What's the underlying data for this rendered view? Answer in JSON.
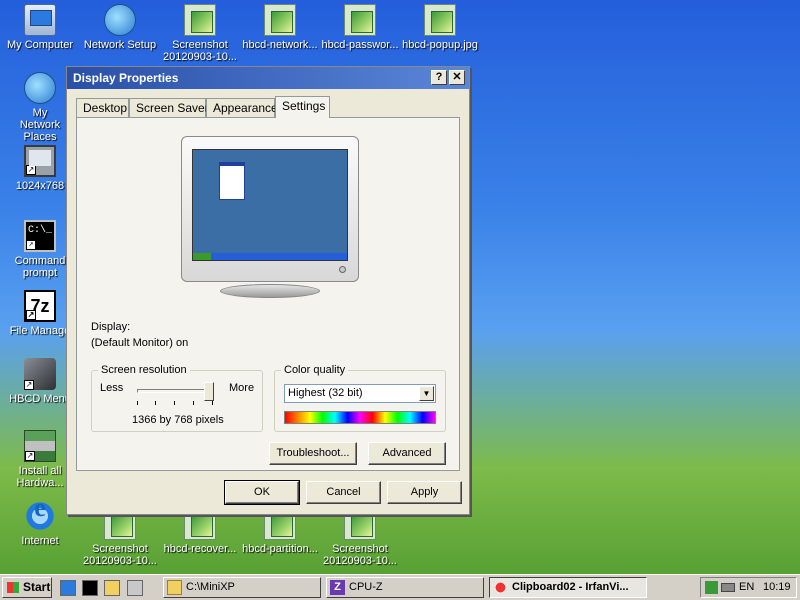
{
  "desktop": {
    "icons_col1": [
      {
        "label": "My Computer"
      },
      {
        "label": "My Network Places"
      },
      {
        "label": "1024x768"
      },
      {
        "label": "Command prompt"
      },
      {
        "label": "File Manage"
      },
      {
        "label": "HBCD Menu"
      },
      {
        "label": "Install all Hardwa..."
      },
      {
        "label": "Internet"
      }
    ],
    "icons_row1": [
      {
        "label": "Network Setup"
      },
      {
        "label": "Screenshot 20120903-10..."
      },
      {
        "label": "hbcd-network..."
      },
      {
        "label": "hbcd-passwor..."
      },
      {
        "label": "hbcd-popup.jpg"
      }
    ],
    "icons_row2": [
      {
        "label": "Screenshot 20120903-10..."
      },
      {
        "label": "hbcd-recover..."
      },
      {
        "label": "hbcd-partition..."
      },
      {
        "label": "Screenshot 20120903-10..."
      }
    ]
  },
  "window": {
    "title": "Display Properties",
    "help_btn": "?",
    "close_btn": "✕",
    "tabs": [
      "Desktop",
      "Screen Saver",
      "Appearance",
      "Settings"
    ],
    "active_tab": "Settings",
    "display_label": "Display:",
    "display_value": "(Default Monitor) on",
    "resolution": {
      "legend": "Screen resolution",
      "less": "Less",
      "more": "More",
      "value": "1366 by 768 pixels",
      "slider_level": 0.95
    },
    "color": {
      "legend": "Color quality",
      "selected": "Highest (32 bit)"
    },
    "buttons": {
      "troubleshoot": "Troubleshoot...",
      "advanced": "Advanced",
      "ok": "OK",
      "cancel": "Cancel",
      "apply": "Apply"
    }
  },
  "taskbar": {
    "start": "Start",
    "tasks": [
      "C:\\MiniXP",
      "CPU-Z",
      "Clipboard02 - IrfanVi..."
    ],
    "active_task": "Clipboard02 - IrfanVi...",
    "lang": "EN",
    "clock": "10:19"
  }
}
